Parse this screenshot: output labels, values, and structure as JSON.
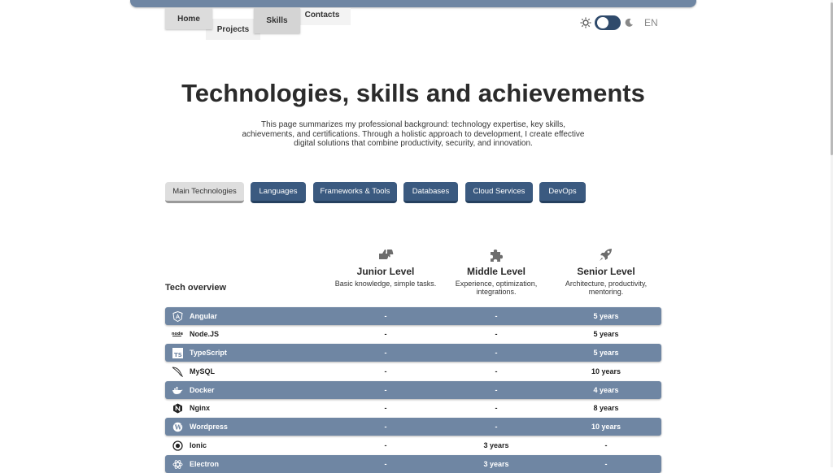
{
  "nav": {
    "home": "Home",
    "projects": "Projects",
    "skills": "Skills",
    "contacts": "Contacts"
  },
  "lang": "EN",
  "page": {
    "title": "Technologies, skills and achievements",
    "intro": "This page summarizes my professional background: technology expertise, key skills, achievements, and certifications. Through a holistic approach to development, I create effective digital solutions that combine productivity, security, and innovation."
  },
  "categories": [
    "Main Technologies",
    "Languages",
    "Frameworks & Tools",
    "Databases",
    "Cloud Services",
    "DevOps"
  ],
  "active_category": "Main Technologies",
  "levels": [
    {
      "title": "Junior Level",
      "desc": "Basic knowledge, simple tasks.",
      "icon": "thumbs-icon"
    },
    {
      "title": "Middle Level",
      "desc": "Experience, optimization, integrations.",
      "icon": "puzzle-icon"
    },
    {
      "title": "Senior Level",
      "desc": "Architecture, productivity, mentoring.",
      "icon": "rocket-icon"
    }
  ],
  "overview_title": "Tech overview",
  "rows": [
    {
      "name": "Angular",
      "junior": "-",
      "middle": "-",
      "senior": "5 years",
      "icon": "angular-icon"
    },
    {
      "name": "Node.JS",
      "junior": "-",
      "middle": "-",
      "senior": "5 years",
      "icon": "nodejs-icon"
    },
    {
      "name": "TypeScript",
      "junior": "-",
      "middle": "-",
      "senior": "5 years",
      "icon": "typescript-icon"
    },
    {
      "name": "MySQL",
      "junior": "-",
      "middle": "-",
      "senior": "10 years",
      "icon": "mysql-icon"
    },
    {
      "name": "Docker",
      "junior": "-",
      "middle": "-",
      "senior": "4 years",
      "icon": "docker-icon"
    },
    {
      "name": "Nginx",
      "junior": "-",
      "middle": "-",
      "senior": "8 years",
      "icon": "nginx-icon"
    },
    {
      "name": "Wordpress",
      "junior": "-",
      "middle": "-",
      "senior": "10 years",
      "icon": "wordpress-icon"
    },
    {
      "name": "Ionic",
      "junior": "-",
      "middle": "3 years",
      "senior": "-",
      "icon": "ionic-icon"
    },
    {
      "name": "Electron",
      "junior": "-",
      "middle": "3 years",
      "senior": "-",
      "icon": "electron-icon"
    }
  ],
  "colors": {
    "accent": "#3b5a80",
    "row_shade": "#6f86a3"
  }
}
